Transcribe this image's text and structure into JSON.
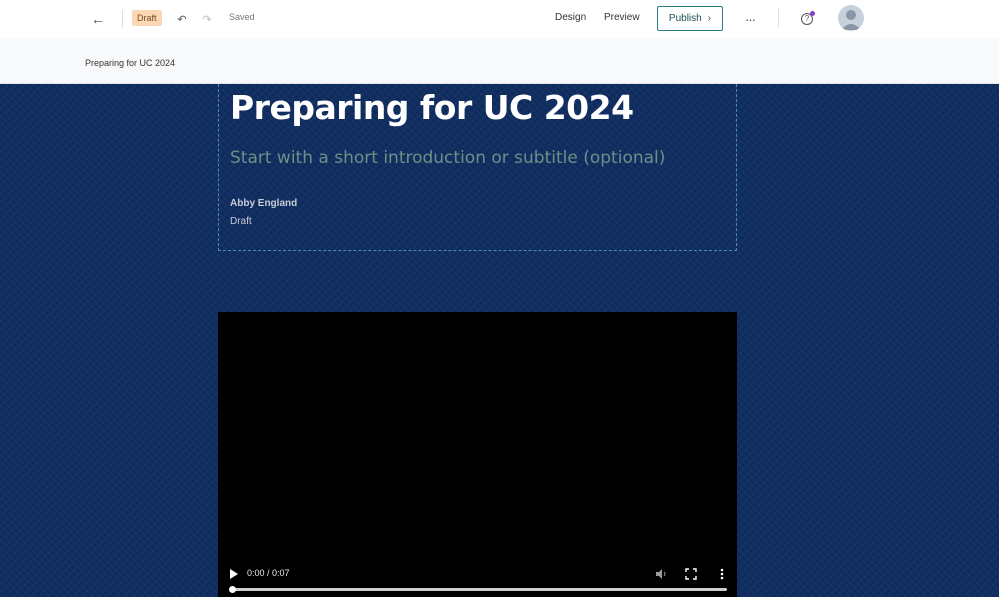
{
  "toolbar": {
    "status_badge": "Draft",
    "saved_label": "Saved",
    "design_label": "Design",
    "preview_label": "Preview",
    "publish_label": "Publish",
    "back_icon": "arrow-left-icon",
    "undo_icon": "undo-icon",
    "redo_icon": "redo-icon",
    "more_icon": "ellipsis-icon",
    "help_icon": "help-icon",
    "avatar_icon": "user-avatar-icon"
  },
  "titlebar": {
    "crumb": "Preparing for UC 2024"
  },
  "story": {
    "title": "Preparing for UC 2024",
    "subtitle_placeholder": "Start with a short introduction or subtitle (optional)",
    "author": "Abby England",
    "status": "Draft"
  },
  "video": {
    "time": "0:00 / 0:07",
    "progress": 0,
    "play_icon": "play-icon",
    "mute_icon": "volume-icon",
    "fullscreen_icon": "fullscreen-icon",
    "menu_icon": "kebab-menu-icon"
  },
  "colors": {
    "canvas": "#0e2b5e",
    "publish_border": "#2c7a86",
    "draft_badge": "#fcd7b6",
    "notification_dot": "#8a3fc6"
  }
}
